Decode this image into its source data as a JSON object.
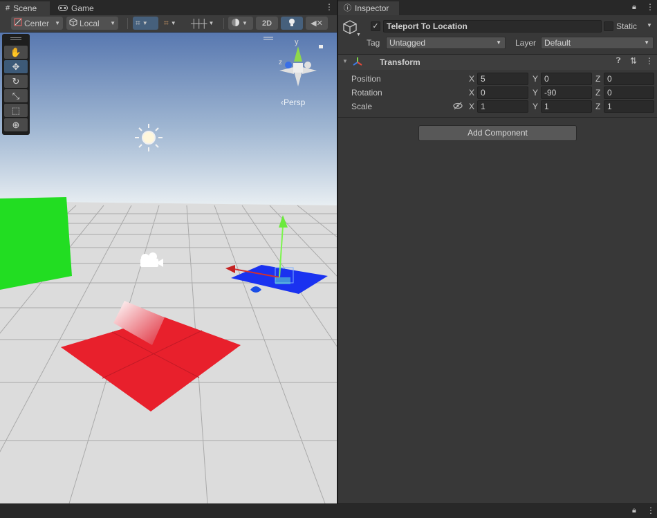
{
  "scene_tabs": {
    "scene": "Scene",
    "game": "Game"
  },
  "scene_toolbar": {
    "pivot": "Center",
    "space": "Local",
    "mode_2d": "2D"
  },
  "viewport": {
    "projection": "‹Persp",
    "gizmo_axis_y": "y",
    "gizmo_axis_z": "z"
  },
  "inspector": {
    "tab": "Inspector",
    "object_name": "Teleport To Location",
    "static_label": "Static",
    "tag_label": "Tag",
    "tag_value": "Untagged",
    "layer_label": "Layer",
    "layer_value": "Default",
    "component_title": "Transform",
    "rows": [
      {
        "label": "Position",
        "x": "5",
        "y": "0",
        "z": "0"
      },
      {
        "label": "Rotation",
        "x": "0",
        "y": "-90",
        "z": "0"
      },
      {
        "label": "Scale",
        "x": "1",
        "y": "1",
        "z": "1"
      }
    ],
    "axis_x": "X",
    "axis_y": "Y",
    "axis_z": "Z",
    "add_component": "Add Component"
  },
  "colors": {
    "selection_blue": "#46607c",
    "panel": "#383838"
  }
}
